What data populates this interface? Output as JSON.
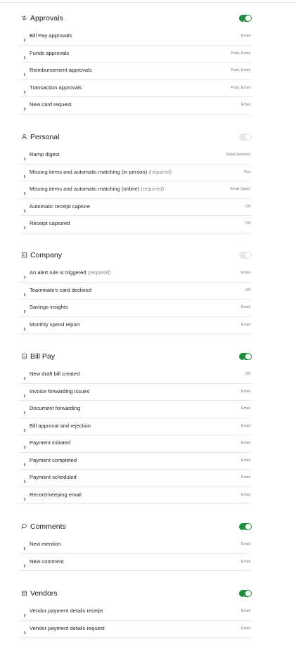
{
  "sections": [
    {
      "title": "Approvals",
      "icon": "arrows-approval-icon",
      "toggle_on": true,
      "rows": [
        {
          "label": "Bill Pay approvals",
          "required": "",
          "value": "Email"
        },
        {
          "label": "Funds approvals",
          "required": "",
          "value": "Push, Email"
        },
        {
          "label": "Reimbursement approvals",
          "required": "",
          "value": "Push, Email"
        },
        {
          "label": "Transaction approvals",
          "required": "",
          "value": "Push, Email"
        },
        {
          "label": "New card request",
          "required": "",
          "value": "Email"
        }
      ]
    },
    {
      "title": "Personal",
      "icon": "person-icon",
      "toggle_on": false,
      "rows": [
        {
          "label": "Ramp digest",
          "required": "",
          "value": "Email (weekly)"
        },
        {
          "label": "Missing items and automatic matching (in person)",
          "required": "(required)",
          "value": "Text"
        },
        {
          "label": "Missing items and automatic matching (online)",
          "required": "(required)",
          "value": "Email (daily)"
        },
        {
          "label": "Automatic receipt capture",
          "required": "",
          "value": "Off"
        },
        {
          "label": "Receipt captured",
          "required": "",
          "value": "Off"
        }
      ]
    },
    {
      "title": "Company",
      "icon": "building-icon",
      "toggle_on": false,
      "rows": [
        {
          "label": "An alert rule is triggered",
          "required": "(required)",
          "value": "Email"
        },
        {
          "label": "Teammate's card declined",
          "required": "",
          "value": "Off"
        },
        {
          "label": "Savings insights",
          "required": "",
          "value": "Email"
        },
        {
          "label": "Monthly spend report",
          "required": "",
          "value": "Email"
        }
      ]
    },
    {
      "title": "Bill Pay",
      "icon": "bill-icon",
      "toggle_on": true,
      "rows": [
        {
          "label": "New draft bill created",
          "required": "",
          "value": "Off"
        },
        {
          "label": "Invoice forwarding issues",
          "required": "",
          "value": "Email"
        },
        {
          "label": "Document forwarding",
          "required": "",
          "value": "Email"
        },
        {
          "label": "Bill approval and rejection",
          "required": "",
          "value": "Email"
        },
        {
          "label": "Payment initiated",
          "required": "",
          "value": "Email"
        },
        {
          "label": "Payment completed",
          "required": "",
          "value": "Email"
        },
        {
          "label": "Payment scheduled",
          "required": "",
          "value": "Email"
        },
        {
          "label": "Record-keeping email",
          "required": "",
          "value": "Email"
        }
      ]
    },
    {
      "title": "Comments",
      "icon": "comment-bubble-icon",
      "toggle_on": true,
      "rows": [
        {
          "label": "New mention",
          "required": "",
          "value": "Email"
        },
        {
          "label": "New comment",
          "required": "",
          "value": "Email"
        }
      ]
    },
    {
      "title": "Vendors",
      "icon": "vendor-store-icon",
      "toggle_on": true,
      "rows": [
        {
          "label": "Vendor payment details receipt",
          "required": "",
          "value": "Email"
        },
        {
          "label": "Vendor payment details request",
          "required": "",
          "value": "Email"
        }
      ]
    }
  ],
  "colors": {
    "toggle_on": "#1e8e3e",
    "toggle_off": "#e8e8e8"
  }
}
